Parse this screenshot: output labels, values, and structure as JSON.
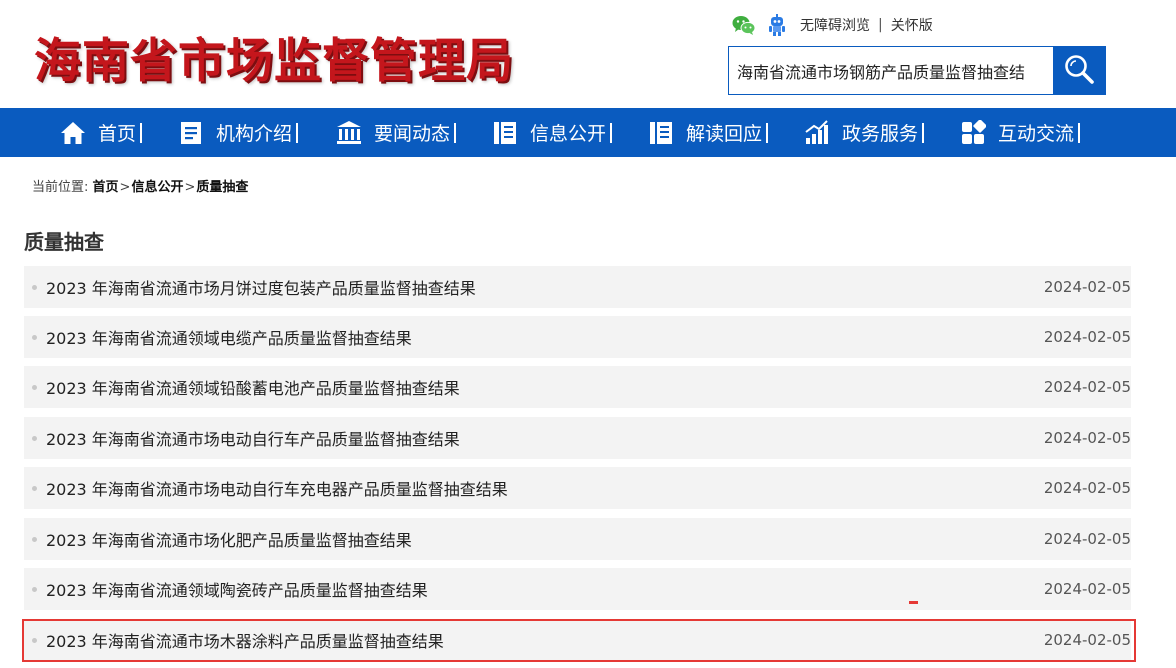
{
  "header": {
    "logo_text": "海南省市场监督管理局",
    "tools": {
      "wechat_icon": "wechat-icon",
      "robot_icon": "robot-icon",
      "accessibility_label": "无障碍浏览",
      "separator": "|",
      "care_label": "关怀版"
    },
    "search": {
      "value": "海南省流通市场钢筋产品质量监督抽查结",
      "button_icon": "search-icon"
    }
  },
  "nav": {
    "items": [
      {
        "label": "首页",
        "icon": "home-icon"
      },
      {
        "label": "机构介绍",
        "icon": "document-icon"
      },
      {
        "label": "要闻动态",
        "icon": "bank-icon"
      },
      {
        "label": "信息公开",
        "icon": "list-book-icon"
      },
      {
        "label": "解读回应",
        "icon": "list-book-icon"
      },
      {
        "label": "政务服务",
        "icon": "bar-chart-icon"
      },
      {
        "label": "互动交流",
        "icon": "grid-icon"
      }
    ],
    "separator": "|"
  },
  "breadcrumb": {
    "prefix": "当前位置:",
    "items": [
      "首页",
      "信息公开",
      "质量抽查"
    ],
    "separator": ">"
  },
  "section_title": "质量抽查",
  "list": [
    {
      "title": "2023 年海南省流通市场月饼过度包装产品质量监督抽查结果",
      "date": "2024-02-05"
    },
    {
      "title": "2023 年海南省流通领域电缆产品质量监督抽查结果",
      "date": "2024-02-05"
    },
    {
      "title": "2023 年海南省流通领域铅酸蓄电池产品质量监督抽查结果",
      "date": "2024-02-05"
    },
    {
      "title": "2023 年海南省流通市场电动自行车产品质量监督抽查结果",
      "date": "2024-02-05"
    },
    {
      "title": "2023 年海南省流通市场电动自行车充电器产品质量监督抽查结果",
      "date": "2024-02-05"
    },
    {
      "title": "2023 年海南省流通市场化肥产品质量监督抽查结果",
      "date": "2024-02-05"
    },
    {
      "title": "2023 年海南省流通领域陶瓷砖产品质量监督抽查结果",
      "date": "2024-02-05"
    },
    {
      "title": "2023 年海南省流通市场木器涂料产品质量监督抽查结果",
      "date": "2024-02-05"
    }
  ],
  "colors": {
    "brand_blue": "#0a5bbf",
    "logo_red": "#c4161c",
    "highlight_red": "#e53935"
  }
}
